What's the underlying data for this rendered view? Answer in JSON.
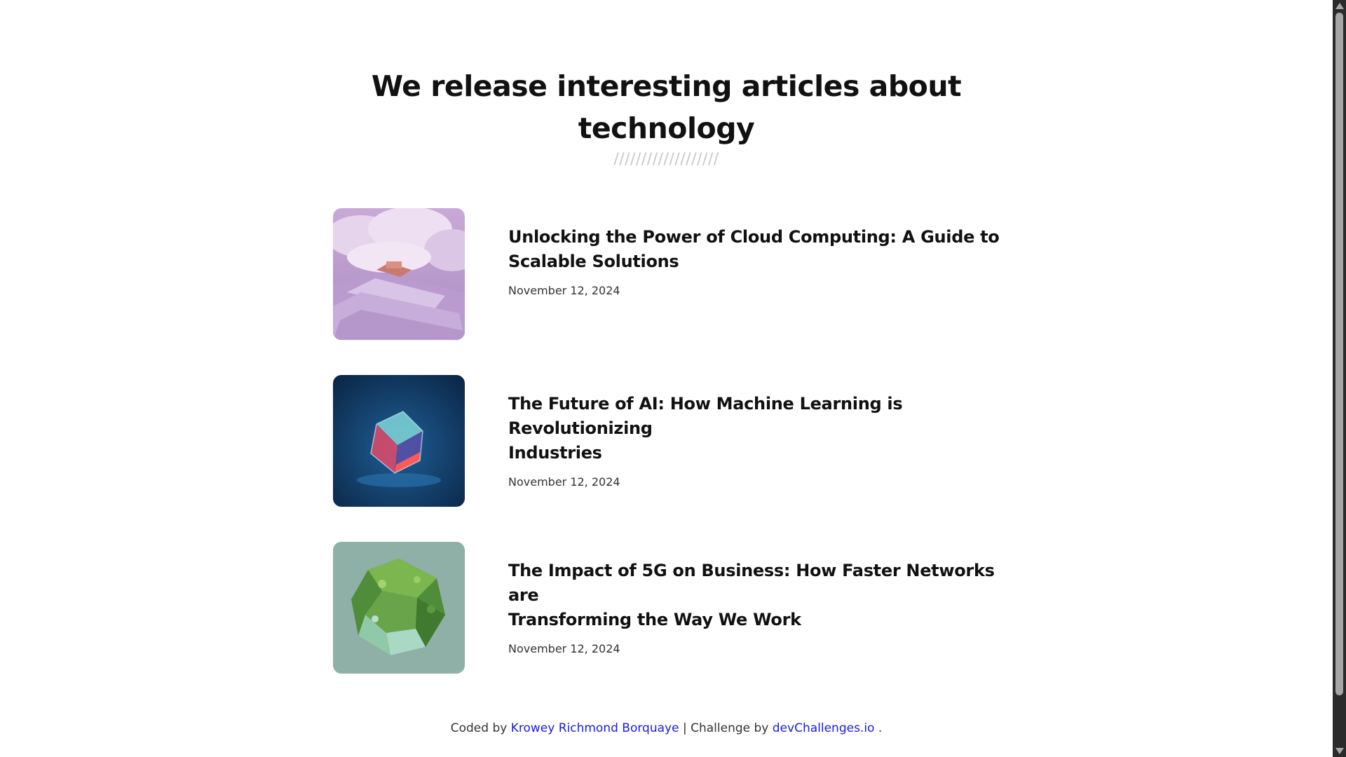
{
  "header": {
    "title_line1": "We release interesting articles about",
    "title_line2": "technology",
    "divider": "///////////////////"
  },
  "articles": [
    {
      "title_line1": "Unlocking the Power of Cloud Computing: A Guide to",
      "title_line2": "Scalable Solutions",
      "date": "November 12, 2024",
      "image": "cloud-staircase-image"
    },
    {
      "title_line1": "The Future of AI: How Machine Learning is Revolutionizing",
      "title_line2": "Industries",
      "date": "November 12, 2024",
      "image": "glass-cube-image"
    },
    {
      "title_line1": "The Impact of 5G on Business: How Faster Networks are",
      "title_line2": "Transforming the Way We Work",
      "date": "November 12, 2024",
      "image": "green-crystal-image"
    }
  ],
  "footer": {
    "prefix": "Coded by",
    "author": "Krowey Richmond Borquaye",
    "separator": "| Challenge by",
    "challenge": "devChallenges.io",
    "suffix": "."
  },
  "colors": {
    "link": "#1a1ae6",
    "divider": "#c8c8c8",
    "text": "#111111"
  }
}
